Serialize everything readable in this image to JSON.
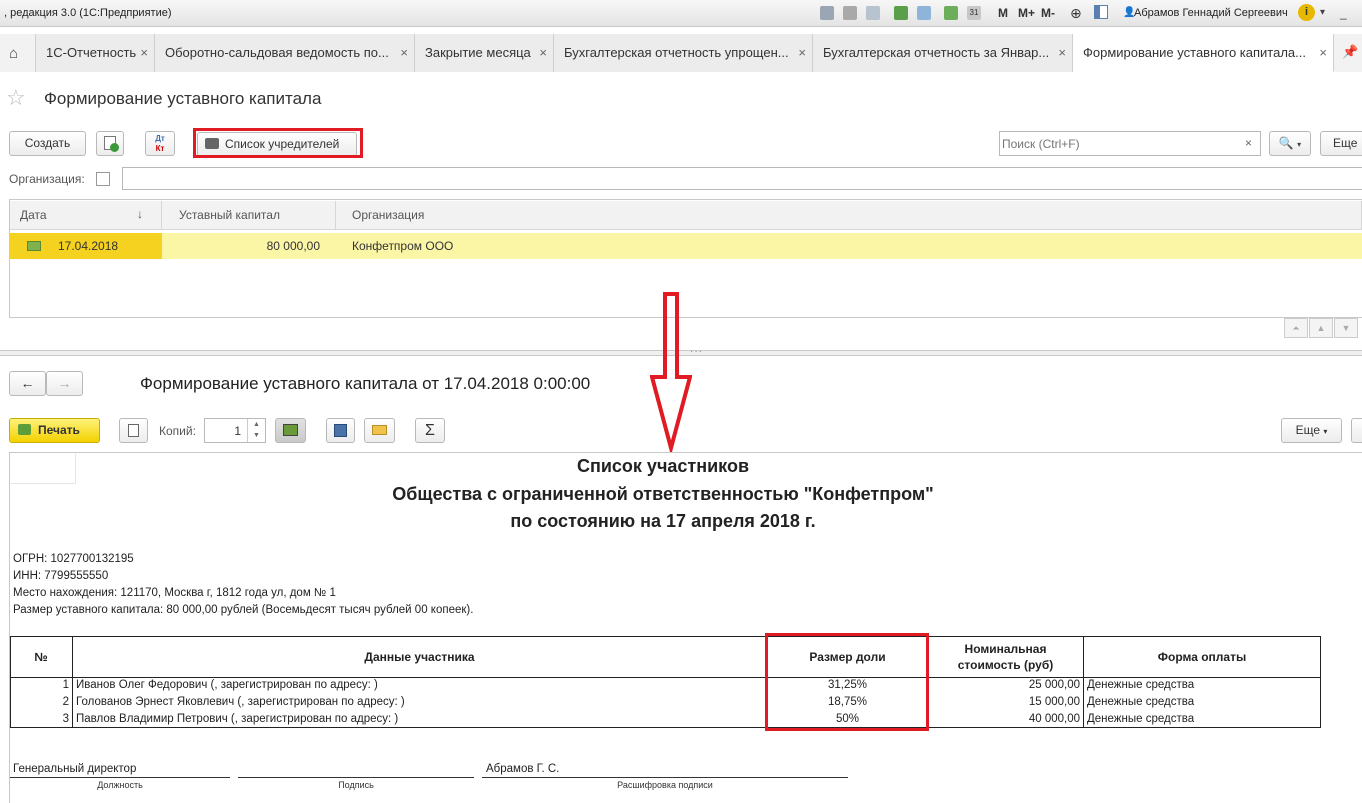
{
  "window": {
    "title": ", редакция 3.0  (1С:Предприятие)",
    "user": "Абрамов Геннадий Сергеевич",
    "toolbar_m": [
      "M",
      "M+",
      "M-"
    ]
  },
  "tabs": [
    {
      "label": "1С-Отчетность"
    },
    {
      "label": "Оборотно-сальдовая ведомость по..."
    },
    {
      "label": "Закрытие месяца"
    },
    {
      "label": "Бухгалтерская отчетность упрощен..."
    },
    {
      "label": "Бухгалтерская отчетность за Январ..."
    },
    {
      "label": "Формирование уставного капитала..."
    }
  ],
  "list": {
    "title": "Формирование уставного капитала",
    "create_label": "Создать",
    "founders_label": "Список учредителей",
    "search_placeholder": "Поиск (Ctrl+F)",
    "more_label": "Еще",
    "org_filter_label": "Организация:",
    "columns": [
      "Дата",
      "Уставный капитал",
      "Организация"
    ],
    "rows": [
      {
        "date": "17.04.2018",
        "capital": "80 000,00",
        "org": "Конфетпром ООО"
      }
    ]
  },
  "doc": {
    "title": "Формирование уставного капитала от 17.04.2018 0:00:00",
    "print_label": "Печать",
    "copies_label": "Копий:",
    "copies_value": "1",
    "more_label": "Еще",
    "sum_icon": "Σ"
  },
  "report": {
    "heading1": "Список участников",
    "heading2": "Общества с ограниченной ответственностью \"Конфетпром\"",
    "heading3": "по состоянию на 17 апреля 2018 г.",
    "ogrn": "ОГРН: 1027700132195",
    "inn": "ИНН: 7799555550",
    "address": "Место нахождения: 121170, Москва г, 1812 года ул, дом № 1",
    "capital": "Размер уставного капитала: 80 000,00 рублей (Восемьдесят тысяч рублей 00 копеек).",
    "columns": {
      "num": "№",
      "member": "Данные участника",
      "share": "Размер доли",
      "nominal": "Номинальная стоимость (руб)",
      "payment": "Форма оплаты"
    },
    "rows": [
      {
        "num": "1",
        "member": "Иванов Олег Федорович (, зарегистрирован по адресу: )",
        "share": "31,25%",
        "nominal": "25 000,00",
        "payment": "Денежные средства"
      },
      {
        "num": "2",
        "member": "Голованов Эрнест Яковлевич (, зарегистрирован по адресу: )",
        "share": "18,75%",
        "nominal": "15 000,00",
        "payment": "Денежные средства"
      },
      {
        "num": "3",
        "member": "Павлов Владимир Петрович (, зарегистрирован по адресу: )",
        "share": "50%",
        "nominal": "40 000,00",
        "payment": "Денежные средства"
      }
    ],
    "signature": {
      "position": "Генеральный директор",
      "name": "Абрамов Г. С.",
      "label_position": "Должность",
      "label_signature": "Подпись",
      "label_name": "Расшифровка подписи"
    }
  }
}
